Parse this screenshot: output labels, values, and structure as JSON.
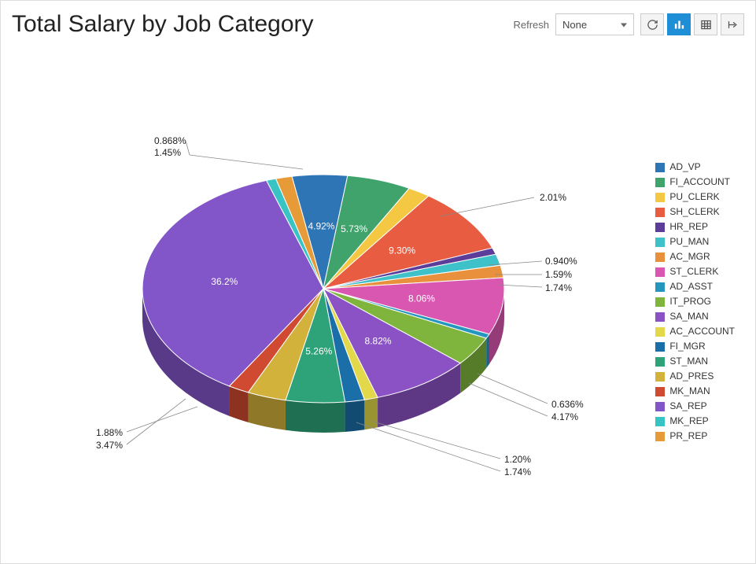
{
  "header": {
    "title": "Total Salary by Job Category",
    "refresh_label": "Refresh",
    "refresh_selected": "None"
  },
  "toolbar": {
    "refresh_btn": "Refresh data",
    "chart_btn": "Chart view",
    "table_btn": "Table view",
    "share_btn": "Share"
  },
  "chart_data": {
    "type": "pie",
    "title": "Total Salary by Job Category",
    "series": [
      {
        "name": "AD_VP",
        "pct": 4.92,
        "color": "#2e75b6"
      },
      {
        "name": "FI_ACCOUNT",
        "pct": 5.73,
        "color": "#3fa36b"
      },
      {
        "name": "PU_CLERK",
        "pct": 2.01,
        "color": "#f4c842"
      },
      {
        "name": "SH_CLERK",
        "pct": 9.3,
        "color": "#e85c41"
      },
      {
        "name": "HR_REP",
        "pct": 0.94,
        "color": "#5c3d99"
      },
      {
        "name": "PU_MAN",
        "pct": 1.59,
        "color": "#3ec1c9"
      },
      {
        "name": "AC_MGR",
        "pct": 1.74,
        "color": "#e8903c"
      },
      {
        "name": "ST_CLERK",
        "pct": 8.06,
        "color": "#d957b0"
      },
      {
        "name": "AD_ASST",
        "pct": 0.636,
        "color": "#2596be"
      },
      {
        "name": "IT_PROG",
        "pct": 4.17,
        "color": "#7fb53d"
      },
      {
        "name": "SA_MAN",
        "pct": 8.82,
        "color": "#8a52c4"
      },
      {
        "name": "AC_ACCOUNT",
        "pct": 1.2,
        "color": "#e3d84a"
      },
      {
        "name": "FI_MGR",
        "pct": 1.74,
        "color": "#1b6fa8"
      },
      {
        "name": "ST_MAN",
        "pct": 5.26,
        "color": "#2ea37a"
      },
      {
        "name": "AD_PRES",
        "pct": 3.47,
        "color": "#d2b23b"
      },
      {
        "name": "MK_MAN",
        "pct": 1.88,
        "color": "#cf4a31"
      },
      {
        "name": "SA_REP",
        "pct": 36.2,
        "color": "#8256c9"
      },
      {
        "name": "MK_REP",
        "pct": 0.868,
        "color": "#38c4c4"
      },
      {
        "name": "PR_REP",
        "pct": 1.45,
        "color": "#e69a38"
      }
    ],
    "label_texts": [
      "4.92%",
      "5.73%",
      "2.01%",
      "9.30%",
      "0.940%",
      "1.59%",
      "1.74%",
      "8.06%",
      "0.636%",
      "4.17%",
      "8.82%",
      "1.20%",
      "1.74%",
      "5.26%",
      "3.47%",
      "1.88%",
      "36.2%",
      "0.868%",
      "1.45%"
    ]
  }
}
